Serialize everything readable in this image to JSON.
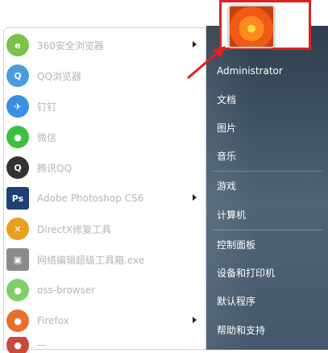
{
  "programs": [
    {
      "label": "360安全浏览器",
      "icon": "browser-360-icon",
      "color": "#7cc24a",
      "glyph": "e",
      "has_arrow": true
    },
    {
      "label": "QQ浏览器",
      "icon": "qq-browser-icon",
      "color": "#4a9be0",
      "glyph": "Q",
      "has_arrow": false
    },
    {
      "label": "钉钉",
      "icon": "dingtalk-icon",
      "color": "#3a8ee6",
      "glyph": "✈",
      "has_arrow": false
    },
    {
      "label": "微信",
      "icon": "wechat-icon",
      "color": "#3fbf3f",
      "glyph": "●",
      "has_arrow": false
    },
    {
      "label": "腾讯QQ",
      "icon": "qq-penguin-icon",
      "color": "#333333",
      "glyph": "Q",
      "has_arrow": false
    },
    {
      "label": "Adobe Photoshop CS6",
      "icon": "photoshop-icon",
      "color": "#1f3f77",
      "glyph": "Ps",
      "has_arrow": true
    },
    {
      "label": "DirectX修复工具",
      "icon": "directx-icon",
      "color": "#e8a020",
      "glyph": "✕",
      "has_arrow": false
    },
    {
      "label": "网络编辑超级工具箱.exe",
      "icon": "network-tool-icon",
      "color": "#8a8a8a",
      "glyph": "▣",
      "has_arrow": false
    },
    {
      "label": "oss-browser",
      "icon": "oss-browser-icon",
      "color": "#7ccf6a",
      "glyph": "●",
      "has_arrow": false
    },
    {
      "label": "Firefox",
      "icon": "firefox-icon",
      "color": "#e8702a",
      "glyph": "●",
      "has_arrow": true
    },
    {
      "label": "—",
      "icon": "app-icon",
      "color": "#c94a3a",
      "glyph": "●",
      "has_arrow": false
    }
  ],
  "user": {
    "name": "Administrator",
    "avatar": "user-avatar-flower"
  },
  "right_items": [
    {
      "key": "documents",
      "label": "文档"
    },
    {
      "key": "pictures",
      "label": "图片"
    },
    {
      "key": "music",
      "label": "音乐"
    },
    {
      "key": "games",
      "label": "游戏"
    },
    {
      "key": "computer",
      "label": "计算机"
    },
    {
      "key": "control-panel",
      "label": "控制面板"
    },
    {
      "key": "devices",
      "label": "设备和打印机"
    },
    {
      "key": "default-programs",
      "label": "默认程序"
    },
    {
      "key": "help",
      "label": "帮助和支持"
    }
  ],
  "colors": {
    "highlight_frame": "#e02020",
    "pointer_arrow": "#e02020",
    "panel_dark": "#3a4d5e"
  }
}
